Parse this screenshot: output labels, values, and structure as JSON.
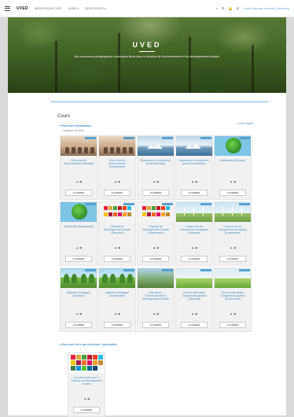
{
  "topbar": {
    "brand": "UVED",
    "nav": [
      "MEDIATHEQUE UVED",
      "GUIDE ▾",
      "RESSOURCES ▾"
    ],
    "user": "Vous n'êtes pas connecté (Connexion)"
  },
  "hero": {
    "title": "UVED",
    "subtitle": "Des ressources pédagogiques numériques libres dans le domaine de l'environnement et du développement durable."
  },
  "main": {
    "section_title": "Cours",
    "collapse_all": "▾ Tout replier",
    "category1": {
      "title": "▾ Parcours thématiques",
      "subtitle": "Catégorie suivante"
    },
    "category2": {
      "title": "▾ Parcours liens par mentions / spécialités"
    },
    "courses": [
      {
        "title": "Avez-vous de l'environnement (Débutant)",
        "meta": "▲ ◀",
        "button": "ACCÉDER",
        "thumb": "class"
      },
      {
        "title": "Avez-vous de l'environnement (Expérimenté)",
        "meta": "▲ ◀",
        "button": "ACCÉDER",
        "thumb": "class"
      },
      {
        "title": "Biodiversité et changement global (Débutant)",
        "meta": "▲ ◀",
        "button": "ACCÉDER",
        "thumb": "ice"
      },
      {
        "title": "Biodiversité et changement global (Expérimenté)",
        "meta": "▲ ◀",
        "button": "ACCÉDER",
        "thumb": "ice"
      },
      {
        "title": "Biodiversité (Débutant)",
        "meta": "▲ ◀",
        "button": "ACCÉDER",
        "thumb": "globe"
      },
      {
        "title": "Biodiversité (Expérimenté)",
        "meta": "▲ ◀",
        "button": "ACCÉDER",
        "thumb": "globe"
      },
      {
        "title": "Objectifs de Développement Durable (Débutant)",
        "meta": "▲ ◀",
        "button": "ACCÉDER",
        "thumb": "sdg"
      },
      {
        "title": "Objectifs de Développement Durable (Expérimenté)",
        "meta": "▲ ◀",
        "button": "ACCÉDER",
        "thumb": "sdg"
      },
      {
        "title": "Comprendre les changements climatiques (Débutant)",
        "meta": "▲ ◀",
        "button": "ACCÉDER",
        "thumb": "wind"
      },
      {
        "title": "Comprendre les changements climatiques (Expérimenté)",
        "meta": "▲ ◀",
        "button": "ACCÉDER",
        "thumb": "wind"
      },
      {
        "title": "Ingénierie écologique (Débutant)",
        "meta": "▲ ◀",
        "button": "ACCÉDER",
        "thumb": "forest"
      },
      {
        "title": "Ingénierie écologique (Expérimenté)",
        "meta": "▲ ◀",
        "button": "ACCÉDER",
        "thumb": "forest"
      },
      {
        "title": "Éducation à l'Environnement au Développement Durable",
        "meta": "▲ ◀",
        "button": "ACCÉDER",
        "thumb": "people"
      },
      {
        "title": "Sécurité alimentaire Changements globaux (Débutant)",
        "meta": "▲ ◀",
        "button": "ACCÉDER",
        "thumb": "field"
      },
      {
        "title": "Sécurité alimentaire Changements globaux (Expérimenté)",
        "meta": "▲ ◀",
        "button": "ACCÉDER",
        "thumb": "field"
      }
    ],
    "single_course": {
      "title": "À la découverte des 17 Objectifs de développement durable",
      "meta": "▲ ◀",
      "button": "ACCÉDER"
    }
  },
  "colors": {
    "accent": "#4a94c7",
    "ribbon": "#5aa1cf"
  }
}
